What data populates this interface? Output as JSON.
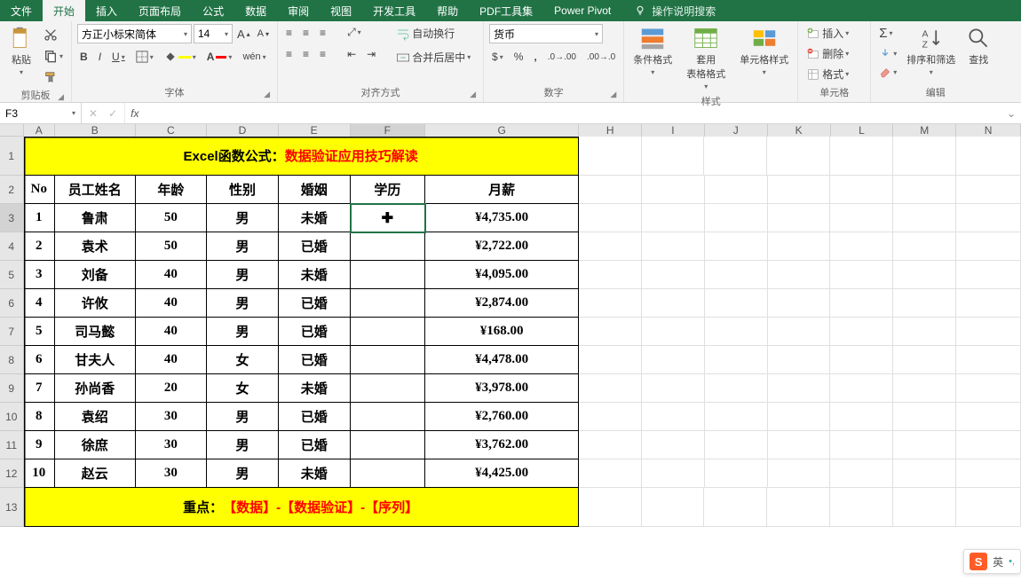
{
  "menubar": {
    "tabs": [
      "文件",
      "开始",
      "插入",
      "页面布局",
      "公式",
      "数据",
      "审阅",
      "视图",
      "开发工具",
      "帮助",
      "PDF工具集",
      "Power Pivot"
    ],
    "active": 1,
    "tell_me": "操作说明搜索"
  },
  "ribbon": {
    "clipboard": {
      "label": "剪贴板",
      "paste": "粘贴"
    },
    "font": {
      "label": "字体",
      "name": "方正小标宋简体",
      "size": "14",
      "btns": {
        "bold": "B",
        "italic": "I",
        "underline": "U",
        "wen": "wén"
      }
    },
    "align": {
      "label": "对齐方式",
      "wrap": "自动换行",
      "merge": "合并后居中"
    },
    "number": {
      "label": "数字",
      "format": "货币"
    },
    "styles": {
      "label": "样式",
      "cond": "条件格式",
      "table": "套用\n表格格式",
      "cell": "单元格样式"
    },
    "cells": {
      "label": "单元格",
      "insert": "插入",
      "delete": "删除",
      "format": "格式"
    },
    "editing": {
      "label": "编辑",
      "sort": "排序和筛选",
      "find": "查找"
    }
  },
  "fbar": {
    "cell_ref": "F3",
    "fx": "fx",
    "formula": ""
  },
  "grid": {
    "cols": [
      "A",
      "B",
      "C",
      "D",
      "E",
      "F",
      "G",
      "H",
      "I",
      "J",
      "K",
      "L",
      "M",
      "N"
    ],
    "active_col": "F",
    "active_row": 3,
    "title": {
      "prefix": "Excel函数公式：",
      "suffix": "数据验证应用技巧解读"
    },
    "headers": [
      "No",
      "员工姓名",
      "年龄",
      "性别",
      "婚姻",
      "学历",
      "月薪"
    ],
    "rows": [
      {
        "no": "1",
        "name": "鲁肃",
        "age": "50",
        "sex": "男",
        "marr": "未婚",
        "edu": "",
        "salary": "¥4,735.00"
      },
      {
        "no": "2",
        "name": "袁术",
        "age": "50",
        "sex": "男",
        "marr": "已婚",
        "edu": "",
        "salary": "¥2,722.00"
      },
      {
        "no": "3",
        "name": "刘备",
        "age": "40",
        "sex": "男",
        "marr": "未婚",
        "edu": "",
        "salary": "¥4,095.00"
      },
      {
        "no": "4",
        "name": "许攸",
        "age": "40",
        "sex": "男",
        "marr": "已婚",
        "edu": "",
        "salary": "¥2,874.00"
      },
      {
        "no": "5",
        "name": "司马懿",
        "age": "40",
        "sex": "男",
        "marr": "已婚",
        "edu": "",
        "salary": "¥168.00"
      },
      {
        "no": "6",
        "name": "甘夫人",
        "age": "40",
        "sex": "女",
        "marr": "已婚",
        "edu": "",
        "salary": "¥4,478.00"
      },
      {
        "no": "7",
        "name": "孙尚香",
        "age": "20",
        "sex": "女",
        "marr": "未婚",
        "edu": "",
        "salary": "¥3,978.00"
      },
      {
        "no": "8",
        "name": "袁绍",
        "age": "30",
        "sex": "男",
        "marr": "已婚",
        "edu": "",
        "salary": "¥2,760.00"
      },
      {
        "no": "9",
        "name": "徐庶",
        "age": "30",
        "sex": "男",
        "marr": "已婚",
        "edu": "",
        "salary": "¥3,762.00"
      },
      {
        "no": "10",
        "name": "赵云",
        "age": "30",
        "sex": "男",
        "marr": "未婚",
        "edu": "",
        "salary": "¥4,425.00"
      }
    ],
    "footer": {
      "prefix": "重点：",
      "suffix": "【数据】-【数据验证】-【序列】"
    }
  },
  "ime": {
    "logo": "S",
    "lang": "英",
    "sym": "•,"
  }
}
